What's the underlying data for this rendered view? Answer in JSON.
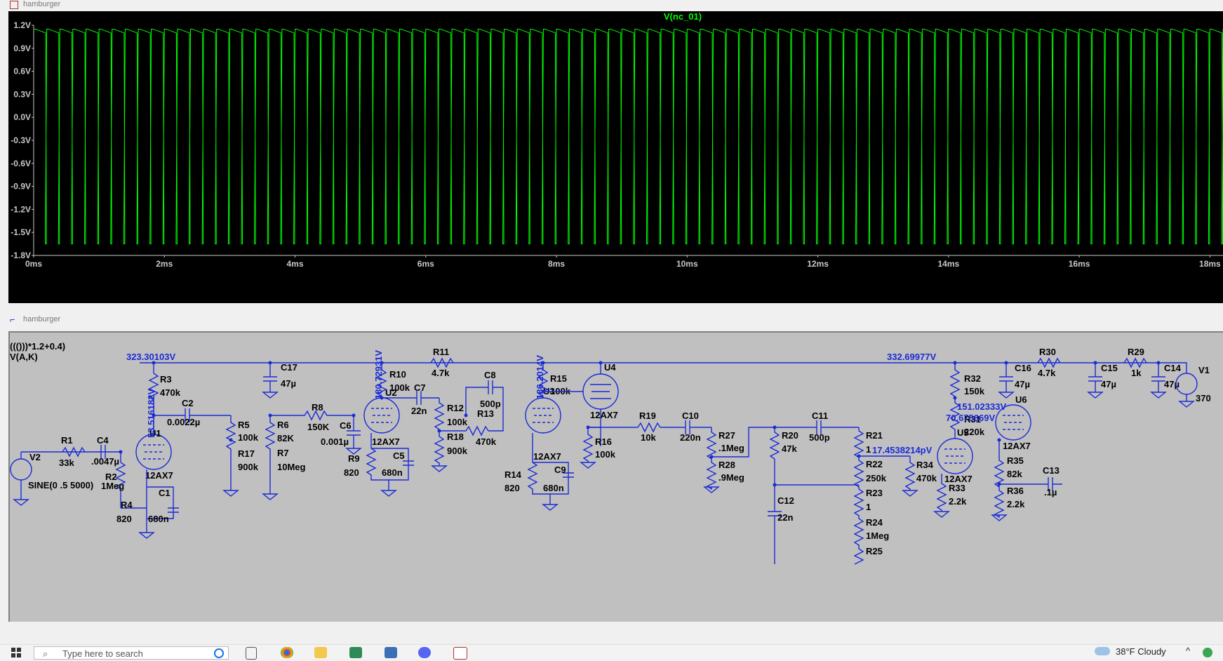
{
  "plot_window": {
    "title": "hamburger",
    "trace_label": "V(nc_01)",
    "y_ticks": [
      "1.2V",
      "0.9V",
      "0.6V",
      "0.3V",
      "0.0V",
      "-0.3V",
      "-0.6V",
      "-0.9V",
      "-1.2V",
      "-1.5V",
      "-1.8V"
    ],
    "x_ticks": [
      "0ms",
      "2ms",
      "4ms",
      "6ms",
      "8ms",
      "10ms",
      "12ms",
      "14ms",
      "16ms",
      "18ms"
    ],
    "trace_color": "#00ff00",
    "background": "#000000"
  },
  "chart_data": {
    "type": "line",
    "title": "V(nc_01)",
    "xlabel": "",
    "ylabel": "",
    "xlim": [
      0,
      18.2
    ],
    "ylim": [
      -1.8,
      1.2
    ],
    "series": [
      {
        "name": "V(nc_01)",
        "shape": "square wave",
        "high": 1.15,
        "low": -1.65,
        "period_ms": 0.2,
        "cycles_visible": 91
      }
    ],
    "grid": false
  },
  "schematic_window": {
    "title": "hamburger",
    "labels": {
      "expr1": "((()))*1.2+0.4)",
      "expr2": "V(A,K)",
      "v_node1": "323.30103V",
      "v_node2": "332.69977V",
      "v_u1": "53.516182V",
      "v_u2": "180.72931V",
      "v_u3": "186.2014V",
      "v_r31": "151.02333V",
      "v_u6": "70.675669V",
      "v_r21": "17.4538214pV",
      "v1_val": "370",
      "v2_src": "SINE(0 .5 5000)"
    },
    "components": [
      {
        "ref": "R1",
        "val": "33k"
      },
      {
        "ref": "C4",
        "val": ".0047µ"
      },
      {
        "ref": "V2",
        "val": ""
      },
      {
        "ref": "R2",
        "val": "1Meg"
      },
      {
        "ref": "R4",
        "val": "820"
      },
      {
        "ref": "C1",
        "val": "680n"
      },
      {
        "ref": "U1",
        "val": "12AX7"
      },
      {
        "ref": "R3",
        "val": "470k"
      },
      {
        "ref": "C2",
        "val": "0.0022µ"
      },
      {
        "ref": "C17",
        "val": "47µ"
      },
      {
        "ref": "R5",
        "val": "100k"
      },
      {
        "ref": "R17",
        "val": "900k"
      },
      {
        "ref": "R6",
        "val": "82K"
      },
      {
        "ref": "R7",
        "val": "10Meg"
      },
      {
        "ref": "R8",
        "val": "150K"
      },
      {
        "ref": "C6",
        "val": "0.001µ"
      },
      {
        "ref": "R9",
        "val": "820"
      },
      {
        "ref": "C5",
        "val": "680n"
      },
      {
        "ref": "U2",
        "val": "12AX7"
      },
      {
        "ref": "R10",
        "val": "100k"
      },
      {
        "ref": "R11",
        "val": "4.7k"
      },
      {
        "ref": "C7",
        "val": "22n"
      },
      {
        "ref": "R12",
        "val": "100k"
      },
      {
        "ref": "R18",
        "val": "900k"
      },
      {
        "ref": "C8",
        "val": "500p"
      },
      {
        "ref": "R13",
        "val": "470k"
      },
      {
        "ref": "U3",
        "val": "12AX7"
      },
      {
        "ref": "R14",
        "val": "820"
      },
      {
        "ref": "C9",
        "val": "680n"
      },
      {
        "ref": "R15",
        "val": "100k"
      },
      {
        "ref": "U4",
        "val": "12AX7"
      },
      {
        "ref": "R16",
        "val": "100k"
      },
      {
        "ref": "R19",
        "val": "10k"
      },
      {
        "ref": "C10",
        "val": "220n"
      },
      {
        "ref": "R27",
        "val": ".1Meg"
      },
      {
        "ref": "R28",
        "val": ".9Meg"
      },
      {
        "ref": "C11",
        "val": "500p"
      },
      {
        "ref": "R20",
        "val": "47k"
      },
      {
        "ref": "C12",
        "val": "22n"
      },
      {
        "ref": "R21",
        "val": "1"
      },
      {
        "ref": "R22",
        "val": "250k"
      },
      {
        "ref": "R23",
        "val": "1"
      },
      {
        "ref": "R24",
        "val": "1Meg"
      },
      {
        "ref": "R25",
        "val": ""
      },
      {
        "ref": "R32",
        "val": "150k"
      },
      {
        "ref": "R31",
        "val": "220k"
      },
      {
        "ref": "U5",
        "val": "12AX7"
      },
      {
        "ref": "R34",
        "val": "470k"
      },
      {
        "ref": "R33",
        "val": "2.2k"
      },
      {
        "ref": "C16",
        "val": "47µ"
      },
      {
        "ref": "R30",
        "val": "4.7k"
      },
      {
        "ref": "C15",
        "val": "47µ"
      },
      {
        "ref": "R29",
        "val": "1k"
      },
      {
        "ref": "C14",
        "val": "47µ"
      },
      {
        "ref": "V1",
        "val": "370"
      },
      {
        "ref": "U6",
        "val": "12AX7"
      },
      {
        "ref": "R35",
        "val": "82k"
      },
      {
        "ref": "R36",
        "val": "2.2k"
      },
      {
        "ref": "C13",
        "val": ".1µ"
      }
    ]
  },
  "taskbar": {
    "search_placeholder": "Type here to search",
    "weather": "38°F  Cloudy"
  }
}
